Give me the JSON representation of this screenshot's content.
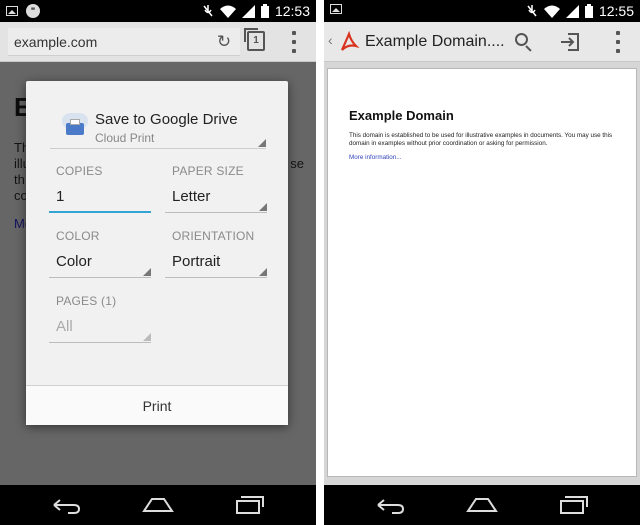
{
  "left_phone": {
    "status_bar": {
      "time": "12:53",
      "notification_icons": [
        "gallery-icon",
        "hangouts-icon"
      ],
      "system_icons": [
        "mute-icon",
        "wifi-icon",
        "signal-icon",
        "battery-icon"
      ]
    },
    "chrome": {
      "url": "example.com",
      "tab_count": "1"
    },
    "background_page": {
      "heading": "E",
      "paragraph_lines": [
        "Th",
        "illu",
        "th",
        "co"
      ],
      "paragraph_right_fragments": [
        "se"
      ],
      "link_fragment": "Mo"
    },
    "print_dialog": {
      "destination": {
        "title": "Save to Google Drive",
        "subtitle": "Cloud Print"
      },
      "copies": {
        "label": "COPIES",
        "value": "1"
      },
      "paper_size": {
        "label": "PAPER SIZE",
        "value": "Letter"
      },
      "color": {
        "label": "COLOR",
        "value": "Color"
      },
      "orientation": {
        "label": "ORIENTATION",
        "value": "Portrait"
      },
      "pages": {
        "label": "PAGES (1)",
        "value": "All"
      },
      "print_button": "Print"
    }
  },
  "right_phone": {
    "status_bar": {
      "time": "12:55",
      "notification_icons": [
        "gallery-icon"
      ],
      "system_icons": [
        "mute-icon",
        "wifi-icon",
        "signal-icon",
        "battery-icon"
      ]
    },
    "toolbar": {
      "title": "Example Domain....",
      "up_caret": "‹"
    },
    "pdf": {
      "heading": "Example Domain",
      "paragraph": "This domain is established to be used for illustrative examples in documents. You may use this domain in examples without prior coordination or asking for permission.",
      "link": "More information..."
    }
  },
  "colors": {
    "accent_underline": "#33a4d4",
    "pdf_red": "#d9321f",
    "dialog_bg": "#f1f1f1"
  }
}
